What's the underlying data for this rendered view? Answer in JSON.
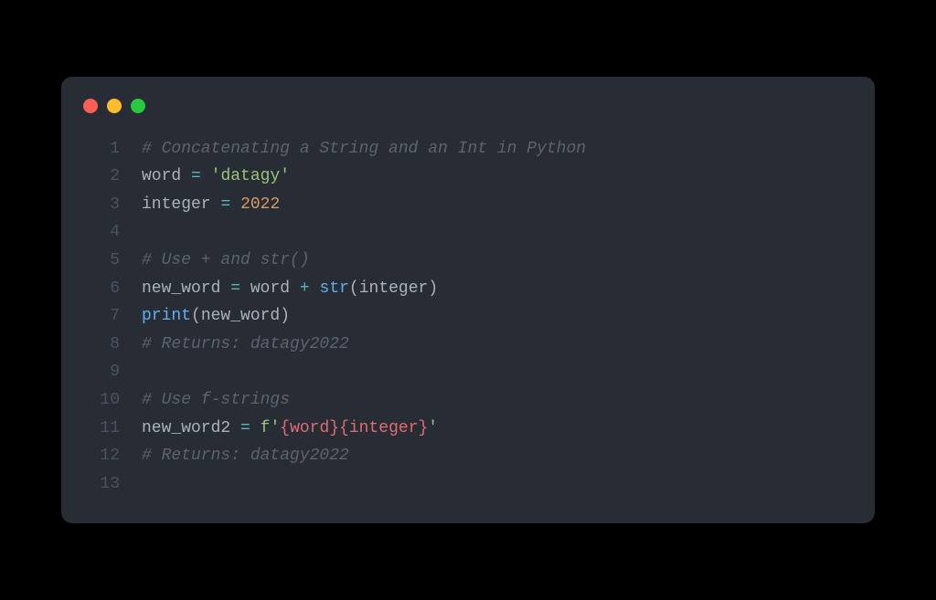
{
  "window": {
    "traffic_lights": [
      "close",
      "minimize",
      "maximize"
    ]
  },
  "code": {
    "lines": [
      {
        "n": "1",
        "tokens": [
          {
            "cls": "comment",
            "t": "# Concatenating a String and an Int in Python"
          }
        ]
      },
      {
        "n": "2",
        "tokens": [
          {
            "cls": "variable",
            "t": "word"
          },
          {
            "cls": "plain",
            "t": " "
          },
          {
            "cls": "operator",
            "t": "="
          },
          {
            "cls": "plain",
            "t": " "
          },
          {
            "cls": "string",
            "t": "'datagy'"
          }
        ]
      },
      {
        "n": "3",
        "tokens": [
          {
            "cls": "variable",
            "t": "integer"
          },
          {
            "cls": "plain",
            "t": " "
          },
          {
            "cls": "operator",
            "t": "="
          },
          {
            "cls": "plain",
            "t": " "
          },
          {
            "cls": "number",
            "t": "2022"
          }
        ]
      },
      {
        "n": "4",
        "tokens": []
      },
      {
        "n": "5",
        "tokens": [
          {
            "cls": "comment",
            "t": "# Use + and str()"
          }
        ]
      },
      {
        "n": "6",
        "tokens": [
          {
            "cls": "variable",
            "t": "new_word"
          },
          {
            "cls": "plain",
            "t": " "
          },
          {
            "cls": "operator",
            "t": "="
          },
          {
            "cls": "plain",
            "t": " "
          },
          {
            "cls": "variable",
            "t": "word"
          },
          {
            "cls": "plain",
            "t": " "
          },
          {
            "cls": "operator",
            "t": "+"
          },
          {
            "cls": "plain",
            "t": " "
          },
          {
            "cls": "builtin",
            "t": "str"
          },
          {
            "cls": "plain",
            "t": "(integer)"
          }
        ]
      },
      {
        "n": "7",
        "tokens": [
          {
            "cls": "builtin",
            "t": "print"
          },
          {
            "cls": "plain",
            "t": "(new_word)"
          }
        ]
      },
      {
        "n": "8",
        "tokens": [
          {
            "cls": "comment",
            "t": "# Returns: datagy2022"
          }
        ]
      },
      {
        "n": "9",
        "tokens": []
      },
      {
        "n": "10",
        "tokens": [
          {
            "cls": "comment",
            "t": "# Use f-strings"
          }
        ]
      },
      {
        "n": "11",
        "tokens": [
          {
            "cls": "variable",
            "t": "new_word2"
          },
          {
            "cls": "plain",
            "t": " "
          },
          {
            "cls": "operator",
            "t": "="
          },
          {
            "cls": "plain",
            "t": " "
          },
          {
            "cls": "string",
            "t": "f'"
          },
          {
            "cls": "fstring-expr",
            "t": "{word}{integer}"
          },
          {
            "cls": "string",
            "t": "'"
          }
        ]
      },
      {
        "n": "12",
        "tokens": [
          {
            "cls": "comment",
            "t": "# Returns: datagy2022"
          }
        ]
      },
      {
        "n": "13",
        "tokens": []
      }
    ]
  }
}
